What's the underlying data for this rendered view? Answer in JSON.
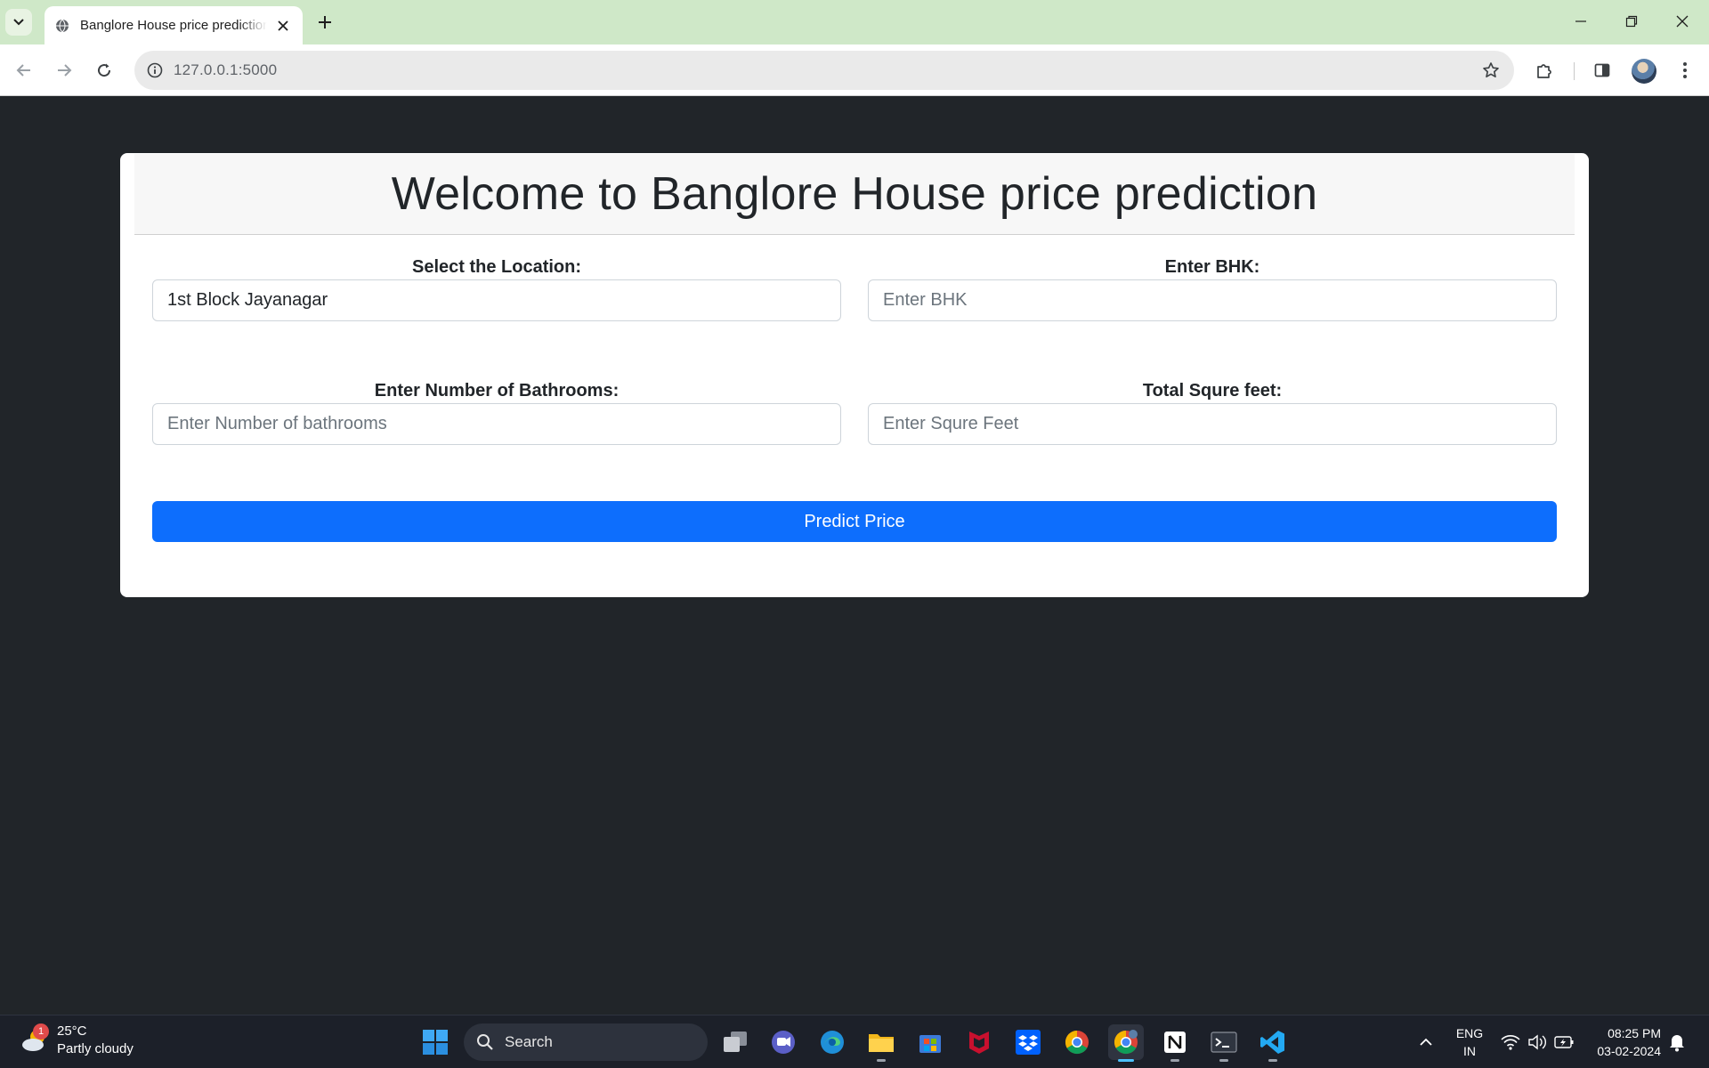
{
  "browser": {
    "tab_title": "Banglore House price prediction",
    "url": "127.0.0.1:5000"
  },
  "page": {
    "title": "Welcome to Banglore House price prediction",
    "location": {
      "label": "Select the Location:",
      "value": "1st Block Jayanagar"
    },
    "bhk": {
      "label": "Enter BHK:",
      "placeholder": "Enter BHK"
    },
    "bathrooms": {
      "label": "Enter Number of Bathrooms:",
      "placeholder": "Enter Number of bathrooms"
    },
    "sqft": {
      "label": "Total Squre feet:",
      "placeholder": "Enter Squre Feet"
    },
    "predict_button": "Predict Price"
  },
  "taskbar": {
    "weather": {
      "temperature": "25°C",
      "condition": "Partly cloudy",
      "badge": "1"
    },
    "search_label": "Search",
    "language_line1": "ENG",
    "language_line2": "IN",
    "time": "08:25 PM",
    "date": "03-02-2024"
  },
  "colors": {
    "page_background": "#212529",
    "primary_button": "#0d6efd",
    "tabbar": "#cfe8c8"
  }
}
